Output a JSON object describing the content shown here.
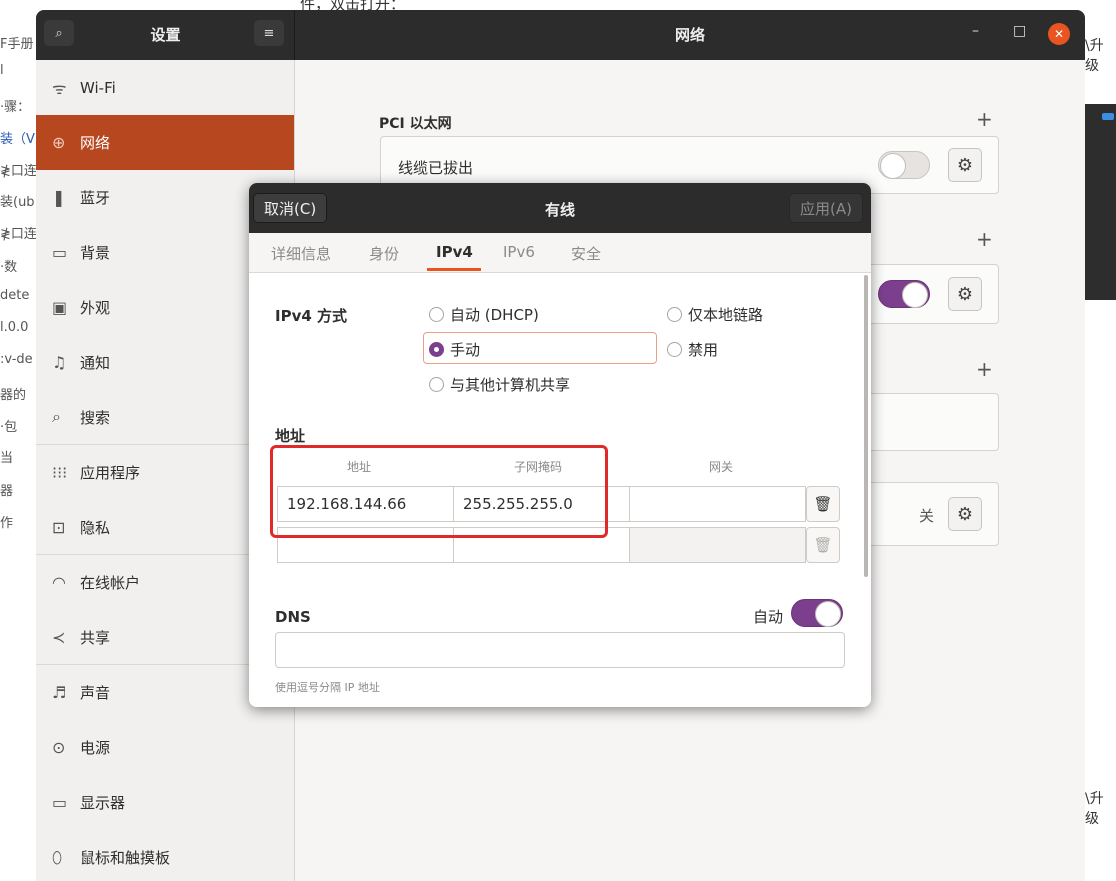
{
  "background": {
    "top_text": "件，双击打开：",
    "left_fragments": [
      "F手册",
      "l",
      "·骤：",
      "装（V",
      "≹口连",
      "装(ub",
      "≹口连",
      "·数",
      "dete",
      "l.0.0",
      ":v-de",
      "器的",
      "·包",
      "当",
      "器",
      "作"
    ],
    "right_fragment_1": "\\升级",
    "right_fragment_2": "\\升级"
  },
  "header": {
    "search_icon": "⌕",
    "sidebar_title": "设置",
    "menu_icon": "≡",
    "panel_title": "网络",
    "minimize_icon": "–",
    "maximize_icon": "□",
    "close_icon": "✕"
  },
  "sidebar": {
    "items": [
      {
        "icon": "ᯤ",
        "label": "Wi-Fi"
      },
      {
        "icon": "⊕",
        "label": "网络"
      },
      {
        "icon": "❚",
        "label": "蓝牙"
      },
      {
        "icon": "▭",
        "label": "背景"
      },
      {
        "icon": "▣",
        "label": "外观"
      },
      {
        "icon": "♫",
        "label": "通知"
      },
      {
        "icon": "⌕",
        "label": "搜索"
      },
      {
        "icon": "⁝⁝⁝",
        "label": "应用程序"
      },
      {
        "icon": "⊡",
        "label": "隐私"
      },
      {
        "icon": "◠",
        "label": "在线帐户"
      },
      {
        "icon": "≺",
        "label": "共享"
      },
      {
        "icon": "♬",
        "label": "声音"
      },
      {
        "icon": "⊙",
        "label": "电源"
      },
      {
        "icon": "▭",
        "label": "显示器"
      },
      {
        "icon": "⬯",
        "label": "鼠标和触摸板"
      }
    ]
  },
  "network": {
    "pci_title": "PCI 以太网",
    "pci_status": "线缆已拔出",
    "plus": "+",
    "gear": "⚙",
    "proxy_value": "关"
  },
  "dialog": {
    "cancel": "取消(C)",
    "title": "有线",
    "apply": "应用(A)",
    "tabs": [
      "详细信息",
      "身份",
      "IPv4",
      "IPv6",
      "安全"
    ],
    "active_tab": "IPv4",
    "ipv4_method_label": "IPv4 方式",
    "methods": {
      "auto": "自动 (DHCP)",
      "link_local": "仅本地链路",
      "manual": "手动",
      "disabled": "禁用",
      "shared": "与其他计算机共享"
    },
    "selected_method": "手动",
    "address_section": "地址",
    "columns": [
      "地址",
      "子网掩码",
      "网关"
    ],
    "rows": [
      {
        "address": "192.168.144.66",
        "netmask": "255.255.255.0",
        "gateway": ""
      },
      {
        "address": "",
        "netmask": "",
        "gateway": ""
      }
    ],
    "trash_icon": "🗑",
    "dns_label": "DNS",
    "dns_auto_label": "自动",
    "dns_auto_on": true,
    "dns_value": "",
    "dns_hint": "使用逗号分隔 IP 地址"
  },
  "colors": {
    "accent": "#e95420",
    "sidebar_active": "#b7471f",
    "toggle_on": "#7b3f8e",
    "highlight_box": "#e02a2a",
    "header_bg": "#2c2c2c"
  }
}
